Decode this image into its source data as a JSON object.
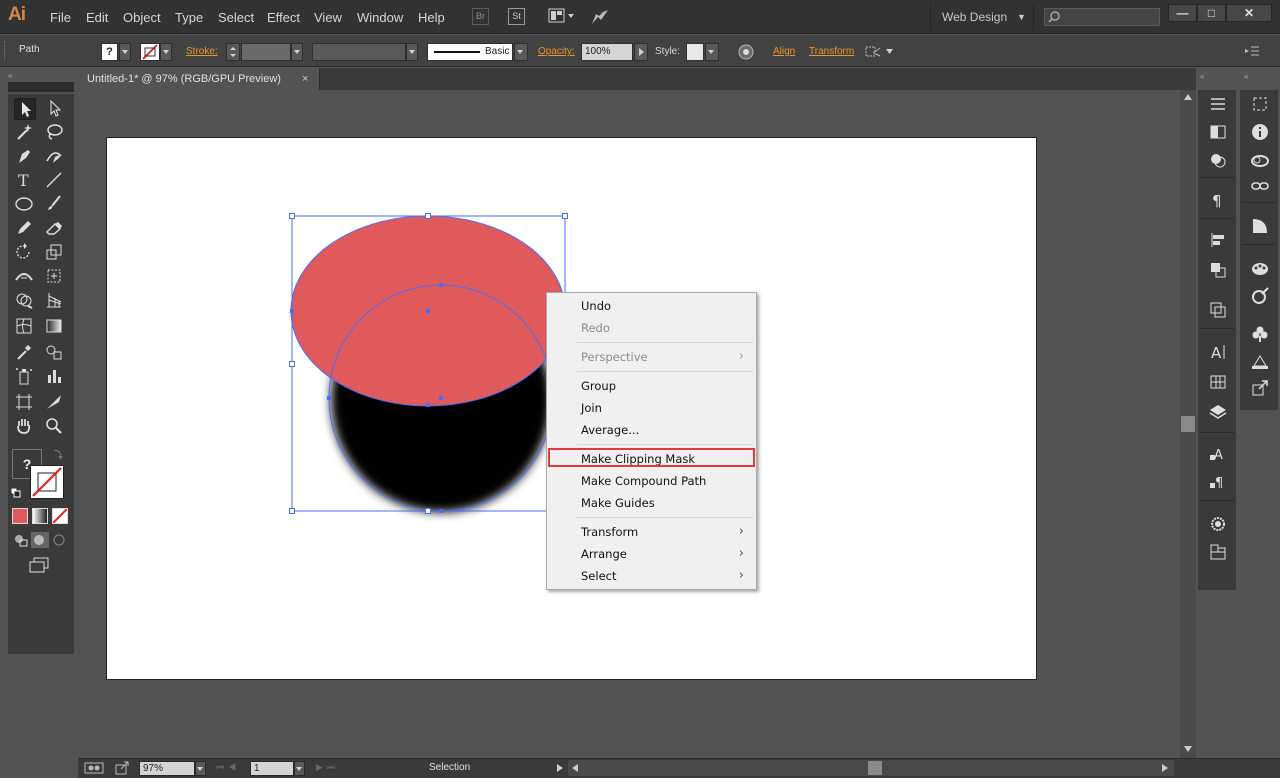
{
  "app": {
    "logo": "Ai",
    "menu": [
      "File",
      "Edit",
      "Object",
      "Type",
      "Select",
      "Effect",
      "View",
      "Window",
      "Help"
    ],
    "bridge_label": "Br",
    "stock_label": "St",
    "workspace": "Web Design",
    "window_buttons": [
      "—",
      "□",
      "✕"
    ]
  },
  "controlbar": {
    "object_type": "Path",
    "fill_label": "?",
    "stroke_label": "Stroke:",
    "brush_label": "Basic",
    "opacity_label": "Opacity:",
    "opacity_value": "100%",
    "style_label": "Style:",
    "align_label": "Align",
    "transform_label": "Transform"
  },
  "document": {
    "tab_title": "Untitled-1* @ 97% (RGB/GPU Preview)",
    "close_glyph": "×"
  },
  "artwork": {
    "ellipse_color": "#e05a5c",
    "shadow_color": "#000000",
    "selection_color": "#4a6cf7"
  },
  "context_menu": {
    "items": [
      {
        "label": "Undo",
        "enabled": true
      },
      {
        "label": "Redo",
        "enabled": false
      },
      {
        "label": "Perspective",
        "enabled": false,
        "submenu": true
      },
      {
        "label": "Group",
        "enabled": true
      },
      {
        "label": "Join",
        "enabled": true
      },
      {
        "label": "Average...",
        "enabled": true
      },
      {
        "label": "Make Clipping Mask",
        "enabled": true,
        "highlighted": true
      },
      {
        "label": "Make Compound Path",
        "enabled": true
      },
      {
        "label": "Make Guides",
        "enabled": true
      },
      {
        "label": "Transform",
        "enabled": true,
        "submenu": true
      },
      {
        "label": "Arrange",
        "enabled": true,
        "submenu": true
      },
      {
        "label": "Select",
        "enabled": true,
        "submenu": true
      }
    ],
    "highlight_color": "#e0393e",
    "submenu_arrow": "›"
  },
  "statusbar": {
    "zoom": "97%",
    "artboard_number": "1",
    "status_text": "Selection"
  },
  "tools": {
    "fill_unknown": "?"
  }
}
